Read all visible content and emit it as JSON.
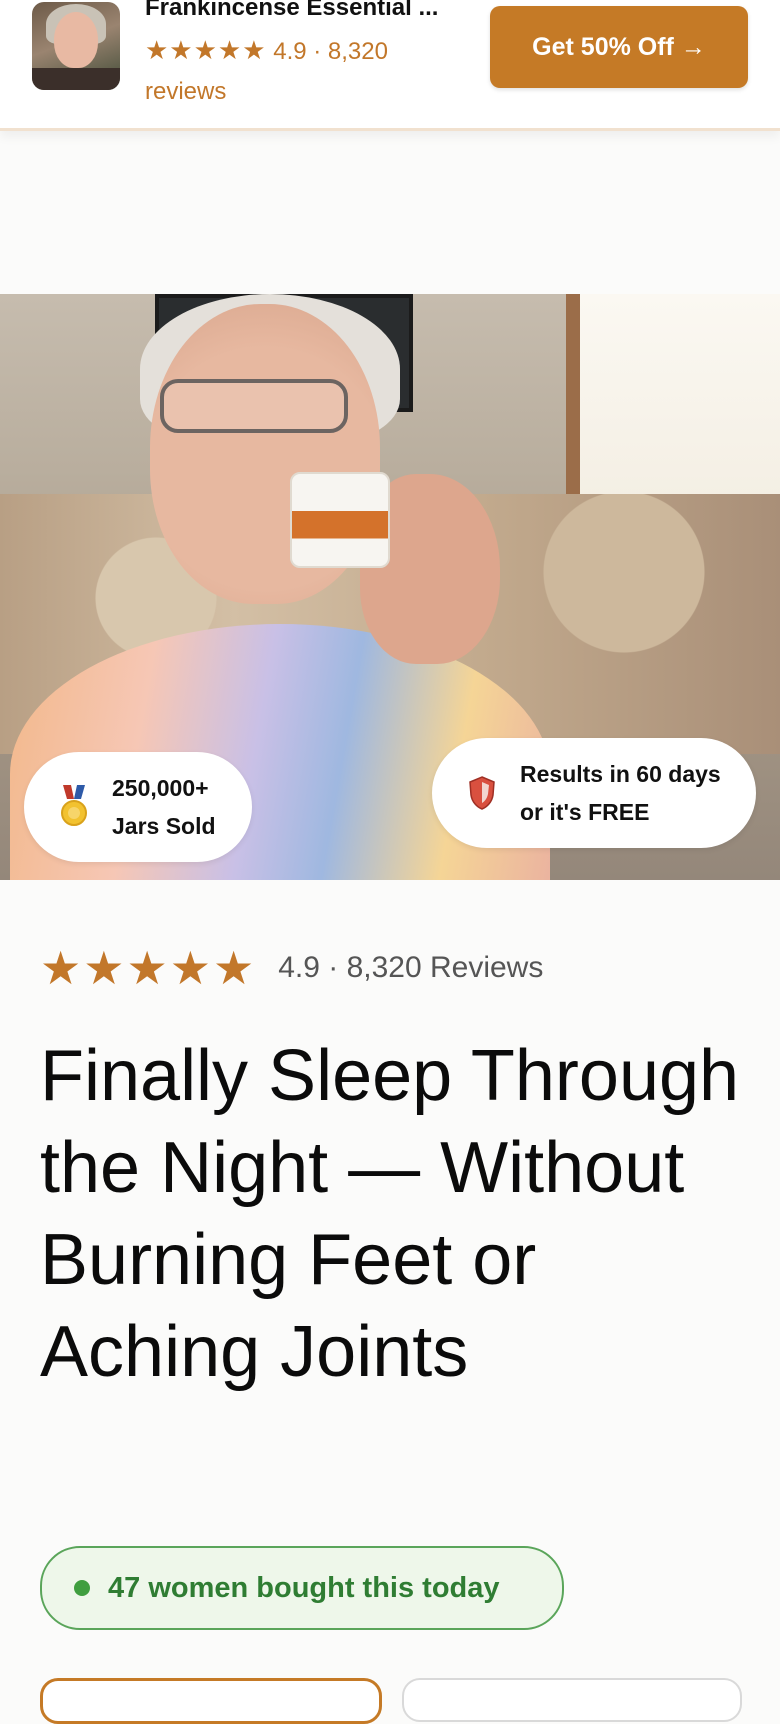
{
  "sticky_bar": {
    "product_title": "Frankincense Essential ...",
    "rating_stars": "★★★★★",
    "rating_text": "4.9 · 8,320",
    "rating_suffix": "reviews",
    "cta_label": "Get 50% Off →"
  },
  "hero": {
    "badges": [
      {
        "icon": "medal-icon",
        "line1": "250,000+",
        "line2": "Jars Sold"
      },
      {
        "icon": "shield-icon",
        "line1": "Results in 60 days",
        "line2": "or it's FREE"
      }
    ]
  },
  "rating": {
    "stars": "★★★★★",
    "text": "4.9 · 8,320 Reviews"
  },
  "headline": "Finally Sleep Through the Night — Without Burning Feet or Aching Joints",
  "social_proof": {
    "text": "47 women bought this today",
    "dot_color": "#3f9e3f"
  },
  "colors": {
    "accent": "#c57a26",
    "star": "#c2772a",
    "proof_green": "#2f7d33"
  }
}
